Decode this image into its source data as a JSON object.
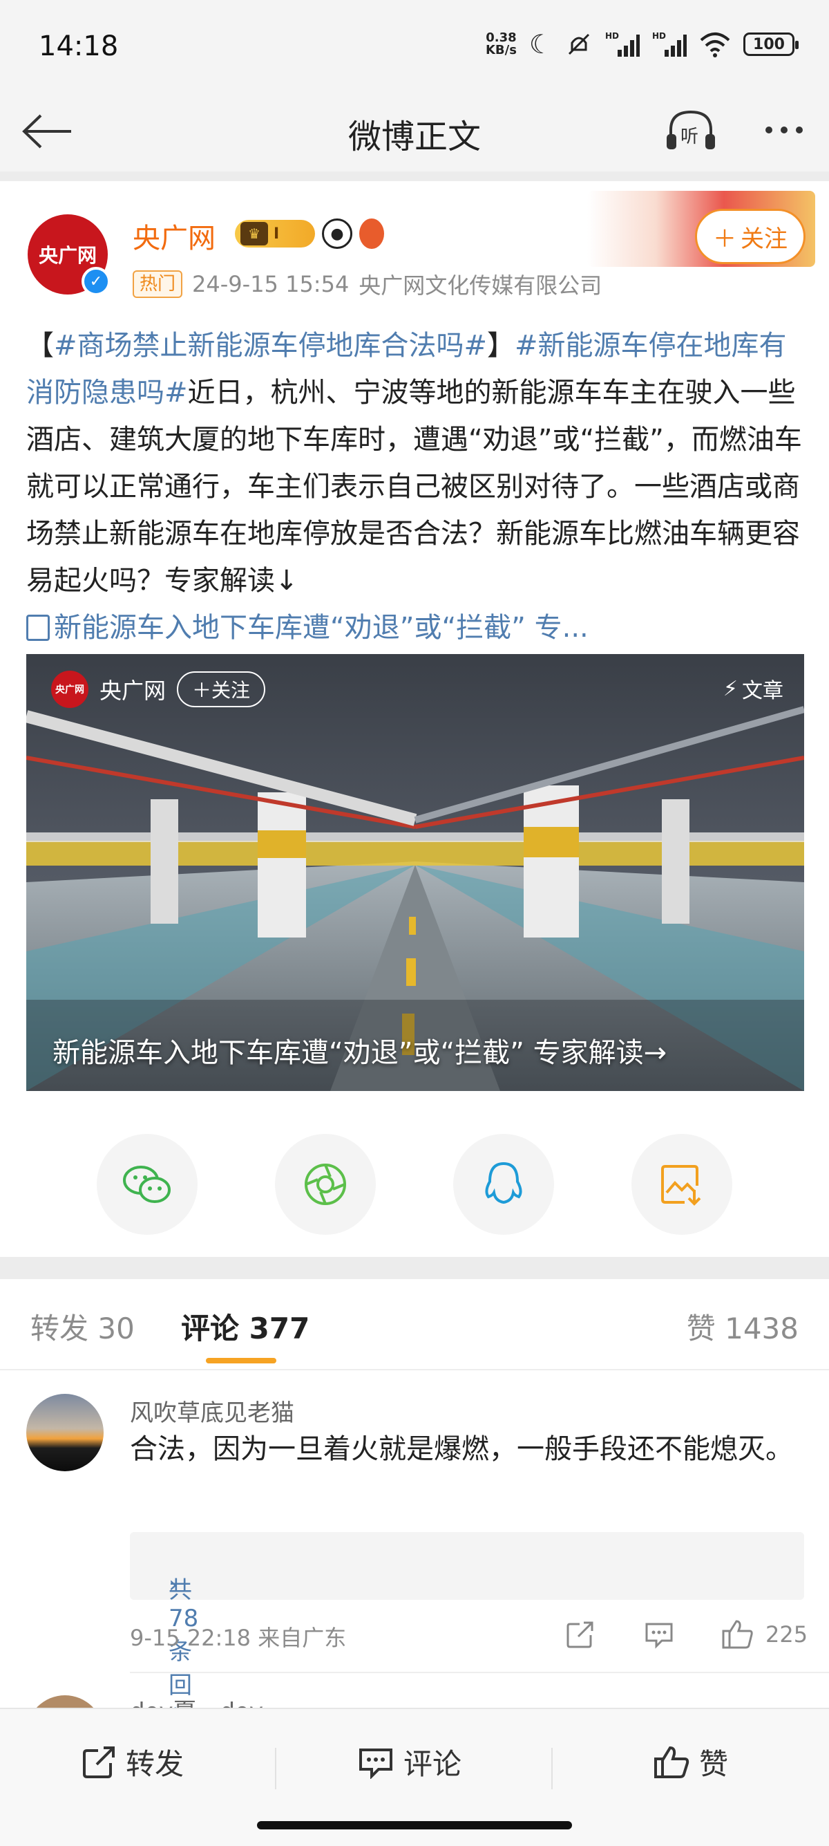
{
  "status_bar": {
    "time": "14:18",
    "net_rate_value": "0.38",
    "net_rate_unit": "KB/s",
    "battery": "100",
    "icons": [
      "moon-icon",
      "mute-icon",
      "signal-hd-icon",
      "signal-hd-icon",
      "wifi-icon",
      "battery-icon"
    ]
  },
  "nav": {
    "title": "微博正文",
    "listen_label": "听"
  },
  "post": {
    "author": "央广网",
    "avatar_text": "央广网",
    "vip_level": "I",
    "hot_tag": "热门",
    "timestamp": "24-9-15 15:54",
    "source": "央广网文化传媒有限公司",
    "follow_label": "关注",
    "text_open": "【",
    "topic1": "#商场禁止新能源车停地库合法吗#",
    "text_close": "】",
    "topic2": "#新能源车停在地库有消防隐患吗#",
    "body": "近日，杭州、宁波等地的新能源车车主在驶入一些酒店、建筑大厦的地下车库时，遭遇“劝退”或“拦截”，而燃油车就可以正常通行，车主们表示自己被区别对待了。一些酒店或商场禁止新能源车在地库停放是否合法？新能源车比燃油车辆更容易起火吗？专家解读↓",
    "link_text": "新能源车入地下车库遭“劝退”或“拦截” 专...",
    "accent_color": "#f07b15",
    "topic_color": "#507daf"
  },
  "card": {
    "account": "央广网",
    "avatar_text": "央广网",
    "follow_label": "关注",
    "type_label": "文章",
    "caption": "新能源车入地下车库遭“劝退”或“拦截” 专家解读→"
  },
  "share": [
    {
      "name": "wechat-icon",
      "color": "#3fb34f"
    },
    {
      "name": "moments-icon",
      "color": "#5cbf4a"
    },
    {
      "name": "qq-icon",
      "color": "#1d9bd7"
    },
    {
      "name": "save-image-icon",
      "color": "#f2a01f"
    }
  ],
  "tabs": {
    "repost": "转发 30",
    "comments": "评论 377",
    "likes": "赞 1438"
  },
  "comment": {
    "user": "风吹草底见老猫",
    "text": "合法，因为一旦着火就是爆燃，一般手段还不能熄灭。",
    "replies_label": "共78条回复",
    "date": "9-15 22:18",
    "location": "来自广东",
    "likes": "225"
  },
  "next_comment": {
    "user": "dov夏—dov"
  },
  "bottom_bar": {
    "repost": "转发",
    "comment": "评论",
    "like": "赞"
  }
}
